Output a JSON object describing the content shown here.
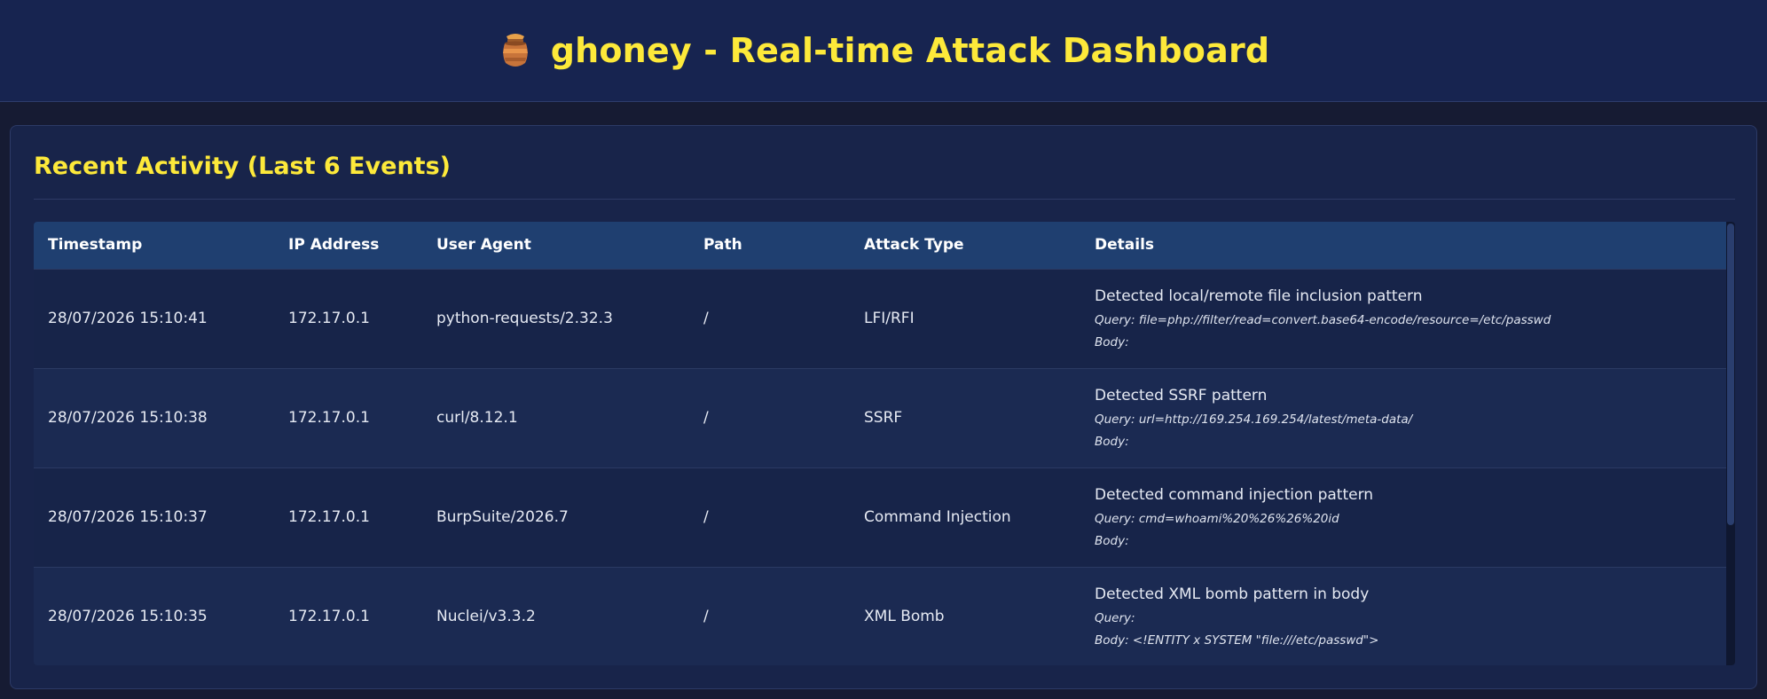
{
  "header": {
    "title": "ghoney - Real-time Attack Dashboard",
    "icon": "honey-pot-icon"
  },
  "panel": {
    "title": "Recent Activity (Last 6 Events)"
  },
  "table": {
    "columns": [
      "Timestamp",
      "IP Address",
      "User Agent",
      "Path",
      "Attack Type",
      "Details"
    ],
    "rows": [
      {
        "timestamp": "28/07/2026 15:10:41",
        "ip": "172.17.0.1",
        "user_agent": "python-requests/2.32.3",
        "path": "/",
        "attack_type": "LFI/RFI",
        "detail": "Detected local/remote file inclusion pattern",
        "query": "Query: file=php://filter/read=convert.base64-encode/resource=/etc/passwd",
        "body": "Body:"
      },
      {
        "timestamp": "28/07/2026 15:10:38",
        "ip": "172.17.0.1",
        "user_agent": "curl/8.12.1",
        "path": "/",
        "attack_type": "SSRF",
        "detail": "Detected SSRF pattern",
        "query": "Query: url=http://169.254.169.254/latest/meta-data/",
        "body": "Body:"
      },
      {
        "timestamp": "28/07/2026 15:10:37",
        "ip": "172.17.0.1",
        "user_agent": "BurpSuite/2026.7",
        "path": "/",
        "attack_type": "Command Injection",
        "detail": "Detected command injection pattern",
        "query": "Query: cmd=whoami%20%26%26%20id",
        "body": "Body:"
      },
      {
        "timestamp": "28/07/2026 15:10:35",
        "ip": "172.17.0.1",
        "user_agent": "Nuclei/v3.3.2",
        "path": "/",
        "attack_type": "XML Bomb",
        "detail": "Detected XML bomb pattern in body",
        "query": "Query:",
        "body": "Body: <!ENTITY x SYSTEM \"file:///etc/passwd\">"
      }
    ]
  },
  "colors": {
    "accent": "#fde93a",
    "header_bg": "#172450",
    "table_header_bg": "#1f3f70"
  }
}
